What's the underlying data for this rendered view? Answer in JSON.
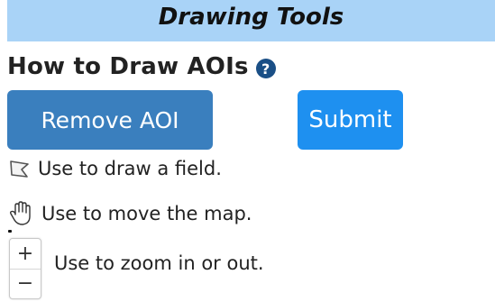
{
  "panel": {
    "title": "Drawing Tools",
    "heading": "How to Draw AOIs",
    "help_icon_glyph": "?",
    "help_icon_name": "help-circle-icon"
  },
  "buttons": {
    "remove_label": "Remove AOI",
    "submit_label": "Submit"
  },
  "instructions": [
    {
      "icon": "polygon-draw-icon",
      "text": "Use to draw a field."
    },
    {
      "icon": "hand-pan-icon",
      "text": "Use to move the map."
    },
    {
      "icon": "zoom-control-icon",
      "text": "Use to zoom in or out."
    }
  ],
  "zoom": {
    "in_glyph": "+",
    "out_glyph": "−"
  },
  "colors": {
    "banner": "#a9d3f7",
    "remove_button": "#3a7fbe",
    "submit_button": "#1e90f0",
    "help_icon": "#1a4f86"
  }
}
